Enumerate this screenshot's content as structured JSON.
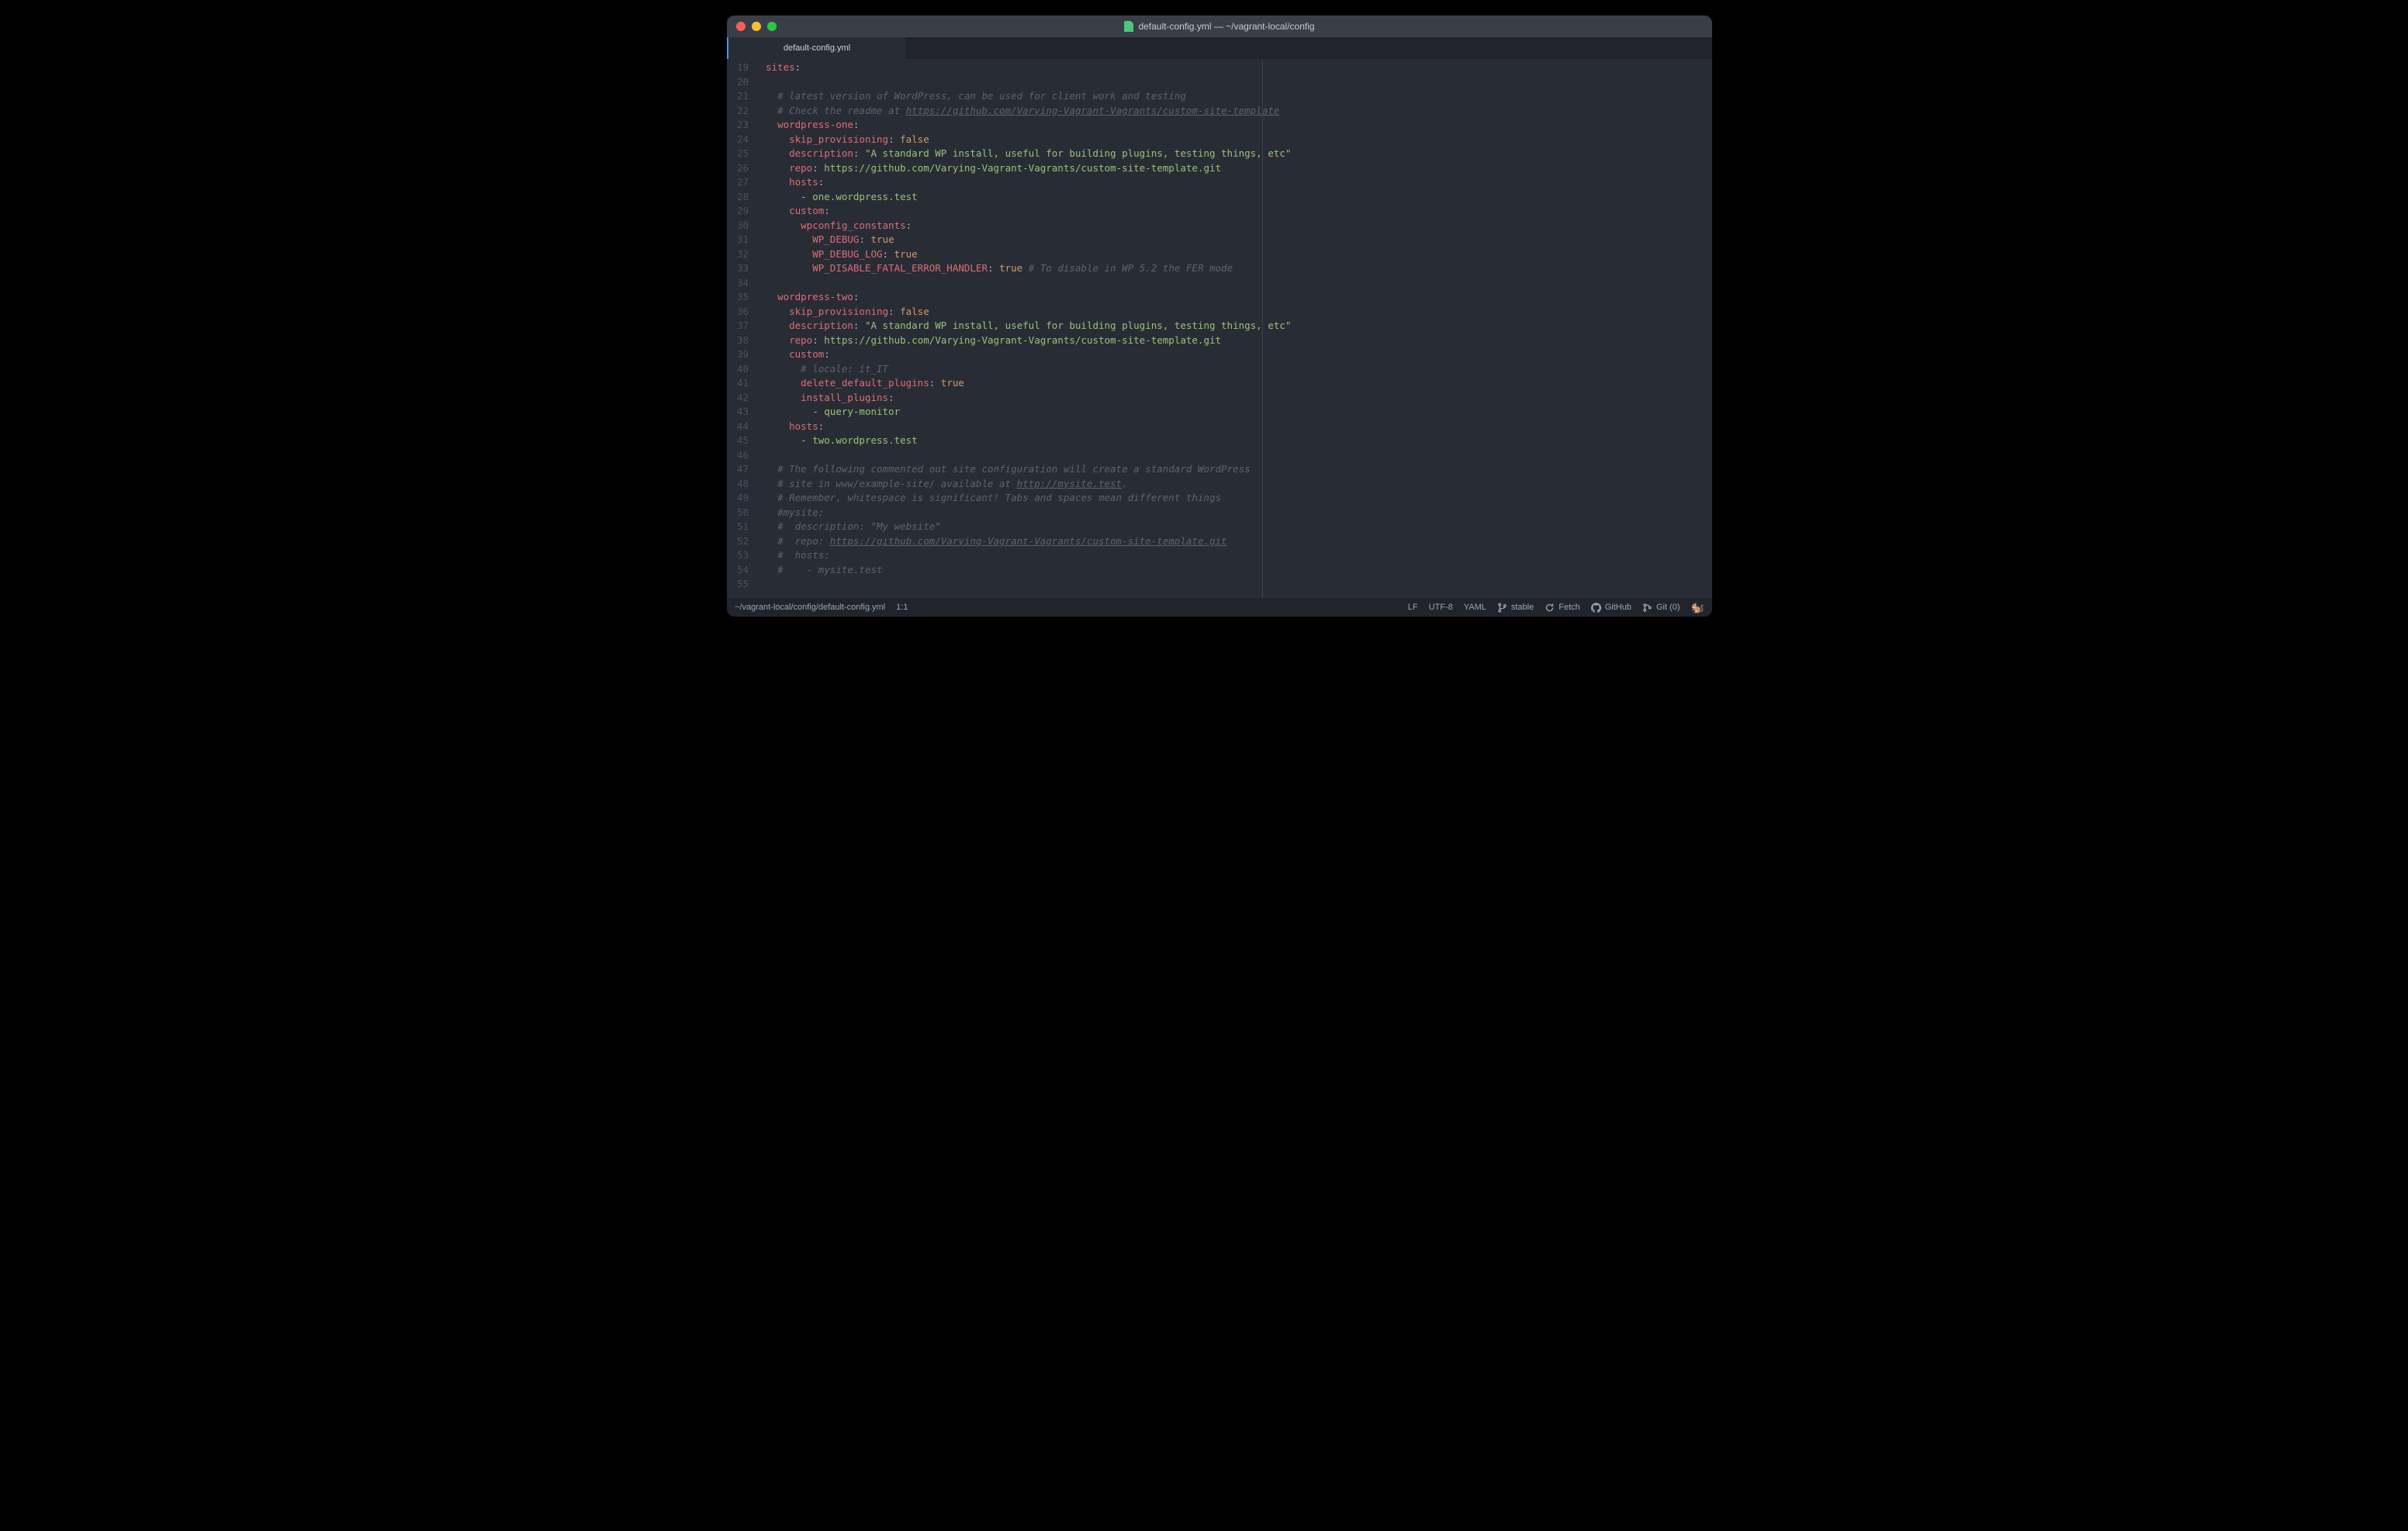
{
  "window": {
    "title": "default-config.yml — ~/vagrant-local/config",
    "tab_label": "default-config.yml"
  },
  "statusbar": {
    "filepath": "~/vagrant-local/config/default-config.yml",
    "cursor": "1:1",
    "line_ending": "LF",
    "encoding": "UTF-8",
    "language": "YAML",
    "branch": "stable",
    "fetch": "Fetch",
    "github": "GitHub",
    "git": "Git (0)"
  },
  "code": {
    "first_line_number": 19,
    "ruler_column": 80,
    "lines": [
      {
        "n": 19,
        "tokens": [
          {
            "t": "sites",
            "c": "k"
          },
          {
            "t": ":",
            "c": "p"
          }
        ]
      },
      {
        "n": 20,
        "tokens": []
      },
      {
        "n": 21,
        "tokens": [
          {
            "t": "  ",
            "c": "p"
          },
          {
            "t": "# latest version of WordPress, can be used for client work and testing",
            "c": "c"
          }
        ]
      },
      {
        "n": 22,
        "tokens": [
          {
            "t": "  ",
            "c": "p"
          },
          {
            "t": "# Check the readme at ",
            "c": "c"
          },
          {
            "t": "https://github.com/Varying-Vagrant-Vagrants/custom-site-template",
            "c": "cu"
          }
        ]
      },
      {
        "n": 23,
        "tokens": [
          {
            "t": "  ",
            "c": "p"
          },
          {
            "t": "wordpress-one",
            "c": "k"
          },
          {
            "t": ":",
            "c": "p"
          }
        ]
      },
      {
        "n": 24,
        "tokens": [
          {
            "t": "    ",
            "c": "p"
          },
          {
            "t": "skip_provisioning",
            "c": "k"
          },
          {
            "t": ": ",
            "c": "p"
          },
          {
            "t": "false",
            "c": "v"
          }
        ]
      },
      {
        "n": 25,
        "tokens": [
          {
            "t": "    ",
            "c": "p"
          },
          {
            "t": "description",
            "c": "k"
          },
          {
            "t": ": ",
            "c": "p"
          },
          {
            "t": "\"A standard WP install, useful for building plugins, testing things, etc\"",
            "c": "s"
          }
        ]
      },
      {
        "n": 26,
        "tokens": [
          {
            "t": "    ",
            "c": "p"
          },
          {
            "t": "repo",
            "c": "k"
          },
          {
            "t": ": ",
            "c": "p"
          },
          {
            "t": "https://github.com/Varying-Vagrant-Vagrants/custom-site-template.git",
            "c": "s"
          }
        ]
      },
      {
        "n": 27,
        "tokens": [
          {
            "t": "    ",
            "c": "p"
          },
          {
            "t": "hosts",
            "c": "k"
          },
          {
            "t": ":",
            "c": "p"
          }
        ]
      },
      {
        "n": 28,
        "tokens": [
          {
            "t": "      - ",
            "c": "p"
          },
          {
            "t": "one.wordpress.test",
            "c": "s"
          }
        ]
      },
      {
        "n": 29,
        "tokens": [
          {
            "t": "    ",
            "c": "p"
          },
          {
            "t": "custom",
            "c": "k"
          },
          {
            "t": ":",
            "c": "p"
          }
        ]
      },
      {
        "n": 30,
        "tokens": [
          {
            "t": "      ",
            "c": "p"
          },
          {
            "t": "wpconfig_constants",
            "c": "k"
          },
          {
            "t": ":",
            "c": "p"
          }
        ]
      },
      {
        "n": 31,
        "tokens": [
          {
            "t": "        ",
            "c": "p"
          },
          {
            "t": "WP_DEBUG",
            "c": "k"
          },
          {
            "t": ": ",
            "c": "p"
          },
          {
            "t": "true",
            "c": "v"
          }
        ]
      },
      {
        "n": 32,
        "tokens": [
          {
            "t": "        ",
            "c": "p"
          },
          {
            "t": "WP_DEBUG_LOG",
            "c": "k"
          },
          {
            "t": ": ",
            "c": "p"
          },
          {
            "t": "true",
            "c": "v"
          }
        ]
      },
      {
        "n": 33,
        "tokens": [
          {
            "t": "        ",
            "c": "p"
          },
          {
            "t": "WP_DISABLE_FATAL_ERROR_HANDLER",
            "c": "k"
          },
          {
            "t": ": ",
            "c": "p"
          },
          {
            "t": "true",
            "c": "v"
          },
          {
            "t": " ",
            "c": "p"
          },
          {
            "t": "# To disable in WP 5.2 the FER mode",
            "c": "c"
          }
        ]
      },
      {
        "n": 34,
        "tokens": []
      },
      {
        "n": 35,
        "tokens": [
          {
            "t": "  ",
            "c": "p"
          },
          {
            "t": "wordpress-two",
            "c": "k"
          },
          {
            "t": ":",
            "c": "p"
          }
        ]
      },
      {
        "n": 36,
        "tokens": [
          {
            "t": "    ",
            "c": "p"
          },
          {
            "t": "skip_provisioning",
            "c": "k"
          },
          {
            "t": ": ",
            "c": "p"
          },
          {
            "t": "false",
            "c": "v"
          }
        ]
      },
      {
        "n": 37,
        "tokens": [
          {
            "t": "    ",
            "c": "p"
          },
          {
            "t": "description",
            "c": "k"
          },
          {
            "t": ": ",
            "c": "p"
          },
          {
            "t": "\"A standard WP install, useful for building plugins, testing things, etc\"",
            "c": "s"
          }
        ]
      },
      {
        "n": 38,
        "tokens": [
          {
            "t": "    ",
            "c": "p"
          },
          {
            "t": "repo",
            "c": "k"
          },
          {
            "t": ": ",
            "c": "p"
          },
          {
            "t": "https://github.com/Varying-Vagrant-Vagrants/custom-site-template.git",
            "c": "s"
          }
        ]
      },
      {
        "n": 39,
        "tokens": [
          {
            "t": "    ",
            "c": "p"
          },
          {
            "t": "custom",
            "c": "k"
          },
          {
            "t": ":",
            "c": "p"
          }
        ]
      },
      {
        "n": 40,
        "tokens": [
          {
            "t": "      ",
            "c": "p"
          },
          {
            "t": "# locale: it_IT",
            "c": "c"
          }
        ]
      },
      {
        "n": 41,
        "tokens": [
          {
            "t": "      ",
            "c": "p"
          },
          {
            "t": "delete_default_plugins",
            "c": "k"
          },
          {
            "t": ": ",
            "c": "p"
          },
          {
            "t": "true",
            "c": "v"
          }
        ]
      },
      {
        "n": 42,
        "tokens": [
          {
            "t": "      ",
            "c": "p"
          },
          {
            "t": "install_plugins",
            "c": "k"
          },
          {
            "t": ":",
            "c": "p"
          }
        ]
      },
      {
        "n": 43,
        "tokens": [
          {
            "t": "        - ",
            "c": "p"
          },
          {
            "t": "query-monitor",
            "c": "s"
          }
        ]
      },
      {
        "n": 44,
        "tokens": [
          {
            "t": "    ",
            "c": "p"
          },
          {
            "t": "hosts",
            "c": "k"
          },
          {
            "t": ":",
            "c": "p"
          }
        ]
      },
      {
        "n": 45,
        "tokens": [
          {
            "t": "      - ",
            "c": "p"
          },
          {
            "t": "two.wordpress.test",
            "c": "s"
          }
        ]
      },
      {
        "n": 46,
        "tokens": []
      },
      {
        "n": 47,
        "tokens": [
          {
            "t": "  ",
            "c": "p"
          },
          {
            "t": "# The following commented out site configuration will create a standard WordPress",
            "c": "c"
          }
        ]
      },
      {
        "n": 48,
        "tokens": [
          {
            "t": "  ",
            "c": "p"
          },
          {
            "t": "# site in www/example-site/ available at ",
            "c": "c"
          },
          {
            "t": "http://mysite.test",
            "c": "cu"
          },
          {
            "t": ".",
            "c": "c"
          }
        ]
      },
      {
        "n": 49,
        "tokens": [
          {
            "t": "  ",
            "c": "p"
          },
          {
            "t": "# Remember, whitespace is significant! Tabs and spaces mean different things",
            "c": "c"
          }
        ]
      },
      {
        "n": 50,
        "tokens": [
          {
            "t": "  ",
            "c": "p"
          },
          {
            "t": "#mysite:",
            "c": "c"
          }
        ]
      },
      {
        "n": 51,
        "tokens": [
          {
            "t": "  ",
            "c": "p"
          },
          {
            "t": "#  description: \"My website\"",
            "c": "c"
          }
        ]
      },
      {
        "n": 52,
        "tokens": [
          {
            "t": "  ",
            "c": "p"
          },
          {
            "t": "#  repo: ",
            "c": "c"
          },
          {
            "t": "https://github.com/Varying-Vagrant-Vagrants/custom-site-template.git",
            "c": "cu"
          }
        ]
      },
      {
        "n": 53,
        "tokens": [
          {
            "t": "  ",
            "c": "p"
          },
          {
            "t": "#  hosts:",
            "c": "c"
          }
        ]
      },
      {
        "n": 54,
        "tokens": [
          {
            "t": "  ",
            "c": "p"
          },
          {
            "t": "#    - mysite.test",
            "c": "c"
          }
        ]
      },
      {
        "n": 55,
        "tokens": []
      }
    ]
  }
}
